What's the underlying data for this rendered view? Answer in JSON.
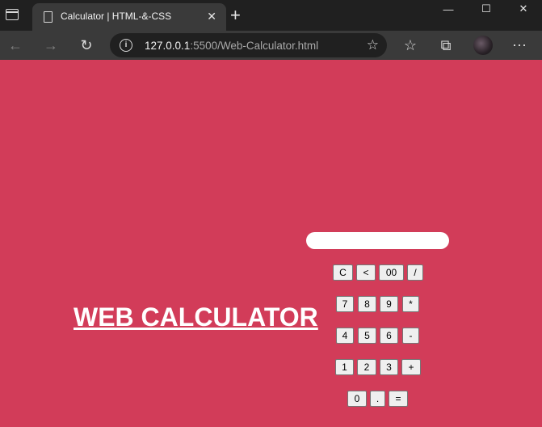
{
  "browser": {
    "tab_title": "Calculator | HTML-&-CSS",
    "tab_close": "✕",
    "new_tab": "+",
    "window_controls": {
      "minimize": "—",
      "maximize": "☐",
      "close": "✕"
    },
    "address": {
      "host": "127.0.0.1",
      "path": ":5500/Web-Calculator.html"
    },
    "toolbar_icons": [
      "back-icon",
      "forward-icon",
      "refresh-icon",
      "info-icon",
      "add-favorite-icon",
      "favorites-icon",
      "collections-icon",
      "profile-avatar",
      "more-icon"
    ],
    "glyphs": {
      "back": "←",
      "forward": "→",
      "refresh": "↻",
      "info": "i",
      "add_fav": "☆",
      "favorites": "☆",
      "collections": "⧉",
      "more": "⋯"
    }
  },
  "page": {
    "title": "WEB CALCULATOR",
    "background": "#d23c59",
    "display_value": "",
    "keys": {
      "row1": [
        "C",
        "<",
        "00",
        "/"
      ],
      "row2": [
        "7",
        "8",
        "9",
        "*"
      ],
      "row3": [
        "4",
        "5",
        "6",
        "-"
      ],
      "row4": [
        "1",
        "2",
        "3",
        "+"
      ],
      "row5": [
        "0",
        ".",
        "="
      ]
    }
  }
}
